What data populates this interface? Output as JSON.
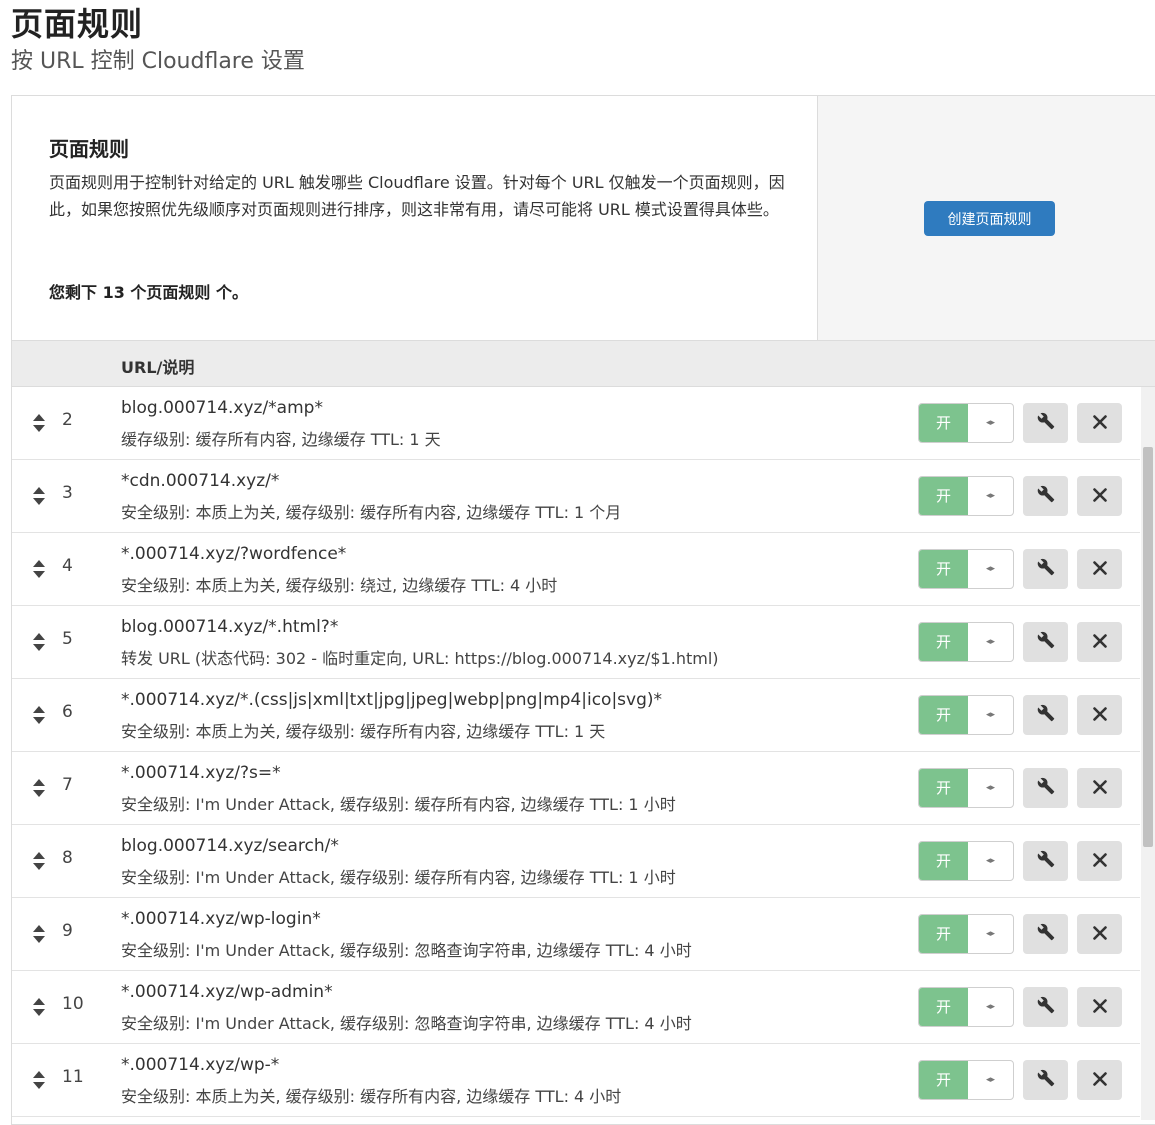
{
  "page": {
    "title": "页面规则",
    "subtitle": "按 URL 控制 Cloudflare 设置"
  },
  "intro": {
    "title": "页面规则",
    "description": "页面规则用于控制针对给定的 URL 触发哪些 Cloudflare 设置。针对每个 URL 仅触发一个页面规则，因此，如果您按照优先级顺序对页面规则进行排序，则这非常有用，请尽可能将 URL 模式设置得具体些。",
    "remaining": "您剩下 13 个页面规则 个。",
    "create_button": "创建页面规则"
  },
  "table": {
    "column_url": "URL/说明",
    "toggle_label": "开",
    "toggle_on_color": "#7dc38e",
    "create_button_color": "#2f7bbf",
    "rows": [
      {
        "priority": "2",
        "url": "blog.000714.xyz/*amp*",
        "settings": "缓存级别: 缓存所有内容, 边缘缓存 TTL: 1 天"
      },
      {
        "priority": "3",
        "url": "*cdn.000714.xyz/*",
        "settings": "安全级别: 本质上为关, 缓存级别: 缓存所有内容, 边缘缓存 TTL: 1 个月"
      },
      {
        "priority": "4",
        "url": "*.000714.xyz/?wordfence*",
        "settings": "安全级别: 本质上为关, 缓存级别: 绕过, 边缘缓存 TTL: 4 小时"
      },
      {
        "priority": "5",
        "url": "blog.000714.xyz/*.html?*",
        "settings": "转发 URL (状态代码: 302 - 临时重定向, URL: https://blog.000714.xyz/$1.html)"
      },
      {
        "priority": "6",
        "url": "*.000714.xyz/*.(css|js|xml|txt|jpg|jpeg|webp|png|mp4|ico|svg)*",
        "settings": "安全级别: 本质上为关, 缓存级别: 缓存所有内容, 边缘缓存 TTL: 1 天"
      },
      {
        "priority": "7",
        "url": "*.000714.xyz/?s=*",
        "settings": "安全级别: I'm Under Attack, 缓存级别: 缓存所有内容, 边缘缓存 TTL: 1 小时"
      },
      {
        "priority": "8",
        "url": "blog.000714.xyz/search/*",
        "settings": "安全级别: I'm Under Attack, 缓存级别: 缓存所有内容, 边缘缓存 TTL: 1 小时"
      },
      {
        "priority": "9",
        "url": "*.000714.xyz/wp-login*",
        "settings": "安全级别: I'm Under Attack, 缓存级别: 忽略查询字符串, 边缘缓存 TTL: 4 小时"
      },
      {
        "priority": "10",
        "url": "*.000714.xyz/wp-admin*",
        "settings": "安全级别: I'm Under Attack, 缓存级别: 忽略查询字符串, 边缘缓存 TTL: 4 小时"
      },
      {
        "priority": "11",
        "url": "*.000714.xyz/wp-*",
        "settings": "安全级别: 本质上为关, 缓存级别: 缓存所有内容, 边缘缓存 TTL: 4 小时"
      }
    ]
  }
}
